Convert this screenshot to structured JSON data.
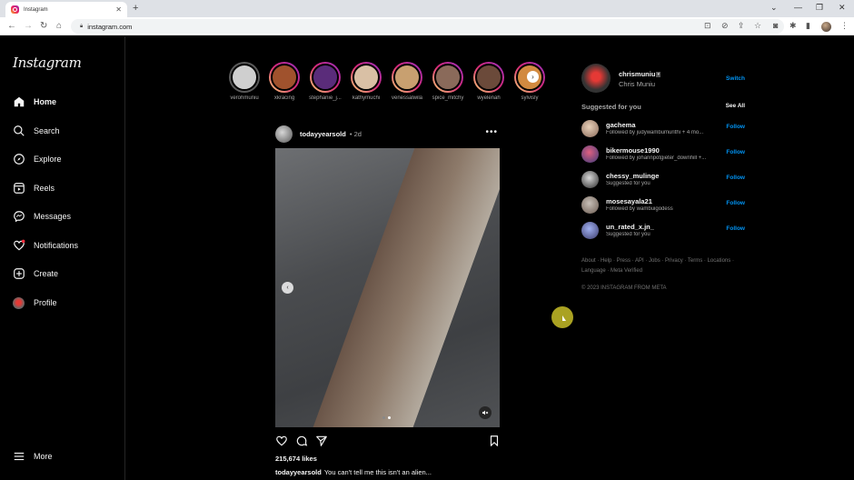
{
  "browser": {
    "tab_title": "Instagram",
    "tab_close": "✕",
    "new_tab": "+",
    "url": "instagram.com",
    "window_controls": [
      "⌄",
      "—",
      "❐",
      "✕"
    ]
  },
  "app": {
    "logo": "Instagram"
  },
  "sidebar": {
    "items": [
      {
        "label": "Home",
        "icon": "home-icon"
      },
      {
        "label": "Search",
        "icon": "search-icon"
      },
      {
        "label": "Explore",
        "icon": "compass-icon"
      },
      {
        "label": "Reels",
        "icon": "reels-icon"
      },
      {
        "label": "Messages",
        "icon": "messenger-icon"
      },
      {
        "label": "Notifications",
        "icon": "heart-icon"
      },
      {
        "label": "Create",
        "icon": "plus-square-icon"
      },
      {
        "label": "Profile",
        "icon": "profile-avatar"
      }
    ],
    "more_label": "More"
  },
  "stories": [
    {
      "name": "verohmuniu",
      "seen": true,
      "color": "#cfcfcf"
    },
    {
      "name": "xkracing",
      "seen": false,
      "color": "#a0522d"
    },
    {
      "name": "stephanie_j...",
      "seen": false,
      "color": "#5a2c7a"
    },
    {
      "name": "kathymuchi",
      "seen": false,
      "color": "#d9c0a5"
    },
    {
      "name": "venessalwila",
      "seen": false,
      "color": "#c8a070"
    },
    {
      "name": "spice_mitchy",
      "seen": false,
      "color": "#8a6a5a"
    },
    {
      "name": "wyelenah",
      "seen": false,
      "color": "#6b4a3a"
    },
    {
      "name": "sylvisly",
      "seen": false,
      "color": "#d28a40"
    }
  ],
  "post": {
    "username": "todayyearsold",
    "time": "• 2d",
    "more": "•••",
    "likes": "215,674 likes",
    "caption_user": "todayyearsold",
    "caption_text": "You can't tell me this isn't an alien..."
  },
  "profile": {
    "username": "chrismuniu",
    "fullname": "Chris Muniu",
    "switch_label": "Switch"
  },
  "suggestions": {
    "title": "Suggested for you",
    "see_all": "See All",
    "follow_label": "Follow",
    "items": [
      {
        "username": "gachema",
        "sub": "Followed by judywambumurithi + 4 mo...",
        "color": "#b08a6a"
      },
      {
        "username": "bikermouse1990",
        "sub": "Followed by johannpotgieter_downhill +...",
        "color": "#c04060"
      },
      {
        "username": "chessy_mulinge",
        "sub": "Suggested for you",
        "color": "#7a5a4a"
      },
      {
        "username": "mosesayala21",
        "sub": "Followed by wambuigodess",
        "color": "#9a8a7a"
      },
      {
        "username": "un_rated_x.jn_",
        "sub": "Suggested for you",
        "color": "#4a5a9a"
      }
    ]
  },
  "footer": {
    "links": "About · Help · Press · API · Jobs · Privacy · Terms · Locations · Language · Meta Verified",
    "copyright": "© 2023 INSTAGRAM FROM META"
  }
}
